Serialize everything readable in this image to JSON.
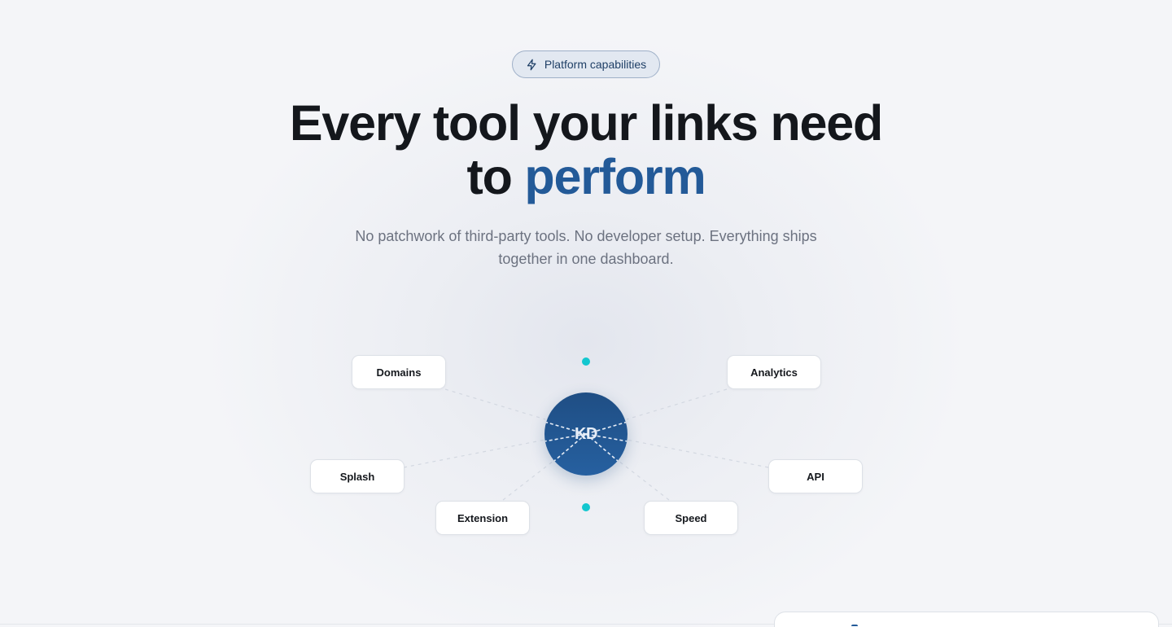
{
  "badge": {
    "icon": "lightning-icon",
    "label": "Platform capabilities",
    "color": "#1f3f66"
  },
  "headline": {
    "line1": "Every tool your links need",
    "line2_prefix": "to",
    "line2_accent": "perform",
    "accent_color": "#235a98"
  },
  "subtitle": "No patchwork of third-party tools. No developer setup. Everything ships together in one dashboard.",
  "hub": {
    "label": "KD",
    "color": "#2660a0"
  },
  "features": [
    {
      "label": "Domains"
    },
    {
      "label": "Analytics"
    },
    {
      "label": "Splash"
    },
    {
      "label": "API"
    },
    {
      "label": "Extension"
    },
    {
      "label": "Speed"
    }
  ],
  "accent_dot_color": "#13c7cf"
}
